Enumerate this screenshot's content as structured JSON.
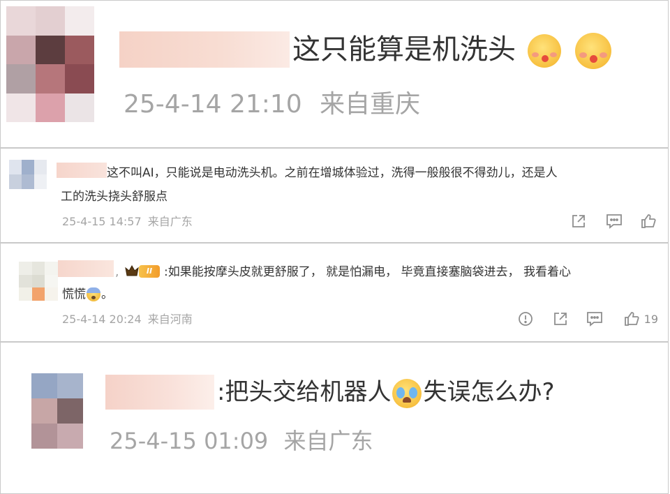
{
  "comments": [
    {
      "text": "这只能算是机洗头",
      "emojis": [
        "yum-face",
        "yum-face"
      ],
      "date": "25-4-14 21:10",
      "location": "来自重庆"
    },
    {
      "line1": "这不叫AI，只能说是电动洗头机。之前在增城体验过，洗得一般般很不得劲儿，还是人",
      "line2": "工的洗头挠头舒服点",
      "date": "25-4-15 14:57",
      "location": "来自广东",
      "actions": [
        "share-icon",
        "comment-icon",
        "like-icon"
      ]
    },
    {
      "badge": "II",
      "line1": ":如果能按摩头皮就更舒服了， 就是怕漏电， 毕竟直接塞脑袋进去， 我看着心",
      "line2": "慌慌",
      "line2_tail": "。",
      "date": "25-4-14 20:24",
      "location": "来自河南",
      "like_count": "19",
      "actions": [
        "report-icon",
        "share-icon",
        "comment-icon",
        "like-icon"
      ]
    },
    {
      "text_before": ":把头交给机器人",
      "text_after": "失误怎么办?",
      "date": "25-4-15 01:09",
      "location": "来自广东"
    }
  ]
}
